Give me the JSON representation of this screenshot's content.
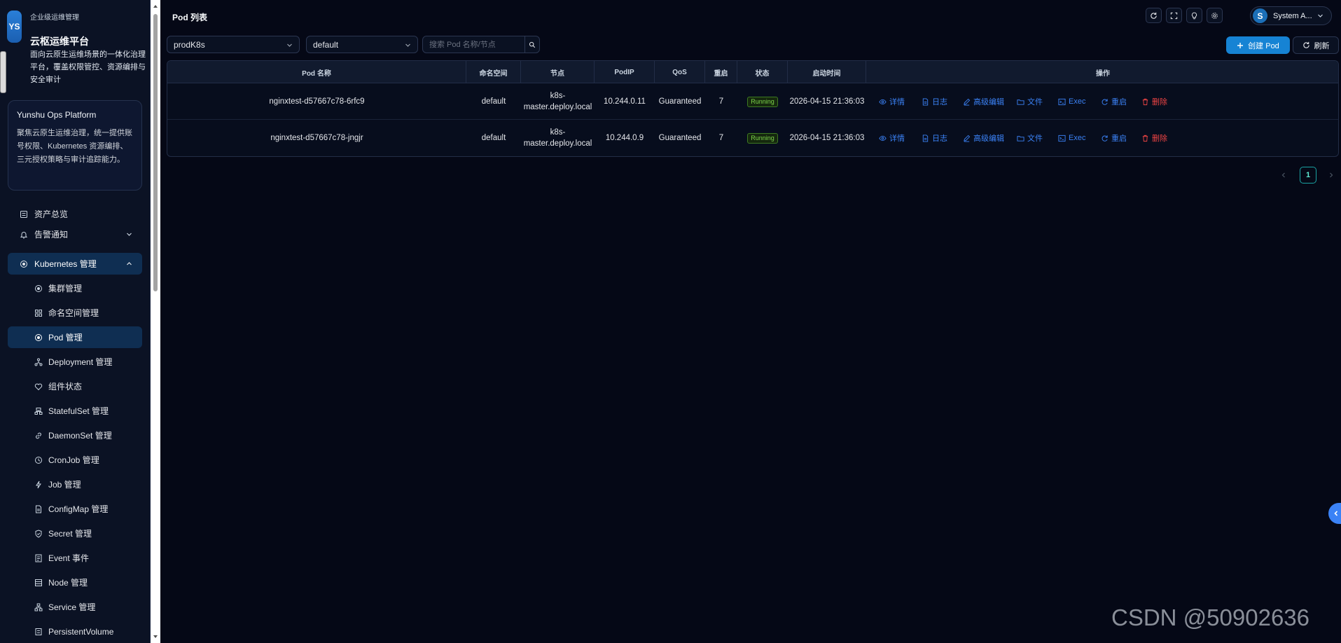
{
  "brand": {
    "logo_text": "YS",
    "sup": "企业级运维管理",
    "title": "云枢运维平台",
    "desc": "面向云原生运维场景的一体化治理平台，覆盖权限管控、资源编排与安全审计"
  },
  "info_card": {
    "title": "Yunshu Ops Platform",
    "desc": "聚焦云原生运维治理，统一提供账号权限、Kubernetes 资源编排、三元授权策略与审计追踪能力。"
  },
  "nav": {
    "items": [
      {
        "label": "资产总览",
        "icon": "list-icon"
      },
      {
        "label": "告警通知",
        "icon": "bell-icon"
      },
      {
        "label": "Kubernetes 管理",
        "icon": "k8s-icon"
      },
      {
        "label": "集群管理",
        "icon": "cluster-icon"
      },
      {
        "label": "命名空间管理",
        "icon": "grid-icon"
      },
      {
        "label": "Pod 管理",
        "icon": "pod-icon"
      },
      {
        "label": "Deployment 管理",
        "icon": "deployment-icon"
      },
      {
        "label": "组件状态",
        "icon": "heart-icon"
      },
      {
        "label": "StatefulSet 管理",
        "icon": "statefulset-icon"
      },
      {
        "label": "DaemonSet 管理",
        "icon": "link-icon"
      },
      {
        "label": "CronJob 管理",
        "icon": "clock-icon"
      },
      {
        "label": "Job 管理",
        "icon": "bolt-icon"
      },
      {
        "label": "ConfigMap 管理",
        "icon": "file-icon"
      },
      {
        "label": "Secret 管理",
        "icon": "shield-icon"
      },
      {
        "label": "Event 事件",
        "icon": "event-icon"
      },
      {
        "label": "Node 管理",
        "icon": "node-icon"
      },
      {
        "label": "Service 管理",
        "icon": "service-icon"
      },
      {
        "label": "PersistentVolume",
        "icon": "volume-icon"
      }
    ]
  },
  "header": {
    "title": "Pod 列表",
    "user_initial": "S",
    "user_name": "System A..."
  },
  "filters": {
    "cluster": "prodK8s",
    "namespace": "default",
    "search_placeholder": "搜索 Pod 名称/节点"
  },
  "actions": {
    "create": "创建 Pod",
    "refresh": "刷新"
  },
  "table": {
    "columns": [
      "Pod 名称",
      "命名空间",
      "节点",
      "PodIP",
      "QoS",
      "重启",
      "状态",
      "启动时间",
      "操作"
    ],
    "rows": [
      {
        "name": "nginxtest-d57667c78-6rfc9",
        "namespace": "default",
        "node_a": "k8s-",
        "node_b": "master.deploy.local",
        "ip": "10.244.0.11",
        "qos": "Guaranteed",
        "restarts": "7",
        "status": "Running",
        "started": "2026-04-15 21:36:03"
      },
      {
        "name": "nginxtest-d57667c78-jngjr",
        "namespace": "default",
        "node_a": "k8s-",
        "node_b": "master.deploy.local",
        "ip": "10.244.0.9",
        "qos": "Guaranteed",
        "restarts": "7",
        "status": "Running",
        "started": "2026-04-15 21:36:03"
      }
    ],
    "row_actions": {
      "detail": "详情",
      "logs": "日志",
      "edit": "高级编辑",
      "files": "文件",
      "exec": "Exec",
      "restart": "重启",
      "delete": "删除"
    }
  },
  "pagination": {
    "current": "1"
  },
  "watermark": "CSDN @50902636",
  "colors": {
    "accent": "#1683d4",
    "link": "#3b82f6",
    "danger": "#ef4444",
    "running": "#7cd34a",
    "background": "#050816",
    "sidebar": "#0b1224"
  }
}
